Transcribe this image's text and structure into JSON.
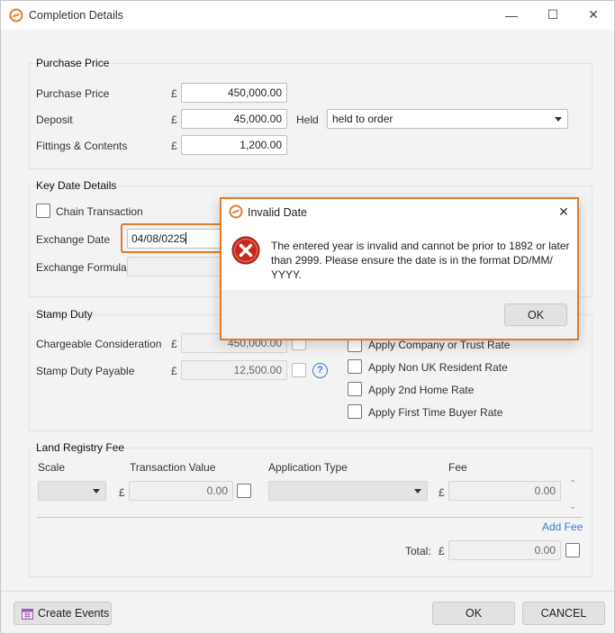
{
  "window": {
    "title": "Completion Details",
    "controls": {
      "minimize": "—",
      "maximize": "☐",
      "close": "✕"
    }
  },
  "purchase_price": {
    "group_title": "Purchase Price",
    "purchase_price_label": "Purchase Price",
    "purchase_price_currency": "£",
    "purchase_price_value": "450,000.00",
    "deposit_label": "Deposit",
    "deposit_currency": "£",
    "deposit_value": "45,000.00",
    "held_label": "Held",
    "held_value": "held to order",
    "fittings_label": "Fittings & Contents",
    "fittings_currency": "£",
    "fittings_value": "1,200.00"
  },
  "key_dates": {
    "group_title": "Key Date Details",
    "chain_transaction_label": "Chain Transaction",
    "chain_transaction_checked": false,
    "exchange_date_label": "Exchange Date",
    "exchange_date_value": "04/08/0225",
    "exchange_formula_label": "Exchange Formula"
  },
  "stamp_duty": {
    "group_title": "Stamp Duty",
    "chargeable_label": "Chargeable Consideration",
    "chargeable_currency": "£",
    "chargeable_value": "450,000.00",
    "payable_label": "Stamp Duty Payable",
    "payable_currency": "£",
    "payable_value": "12,500.00",
    "help_icon_text": "?",
    "rates": [
      {
        "label": "Apply Company or Trust Rate",
        "checked": false
      },
      {
        "label": "Apply Non UK Resident Rate",
        "checked": false
      },
      {
        "label": "Apply 2nd Home Rate",
        "checked": false
      },
      {
        "label": "Apply First Time Buyer Rate",
        "checked": false
      }
    ]
  },
  "land_registry": {
    "group_title": "Land Registry Fee",
    "columns": {
      "scale": "Scale",
      "transaction_value": "Transaction Value",
      "application_type": "Application Type",
      "fee": "Fee"
    },
    "row": {
      "scale": "",
      "currency": "£",
      "transaction_value": "0.00",
      "application_type": "",
      "fee_currency": "£",
      "fee": "0.00"
    },
    "add_fee_link": "Add Fee",
    "total_label": "Total:",
    "total_currency": "£",
    "total_value": "0.00"
  },
  "footer": {
    "create_events_label": "Create Events",
    "ok_label": "OK",
    "cancel_label": "CANCEL"
  },
  "dialog": {
    "title": "Invalid Date",
    "close_glyph": "✕",
    "message": "The entered year is invalid and cannot be prior to 1892 or later than 2999. Please ensure the date is in the format DD/MM/ YYYY.",
    "ok_label": "OK"
  },
  "colors": {
    "accent_orange": "#e07b2a",
    "error_red": "#c42b1c",
    "link_blue": "#3b78d8",
    "calendar_purple": "#9b59b6"
  }
}
